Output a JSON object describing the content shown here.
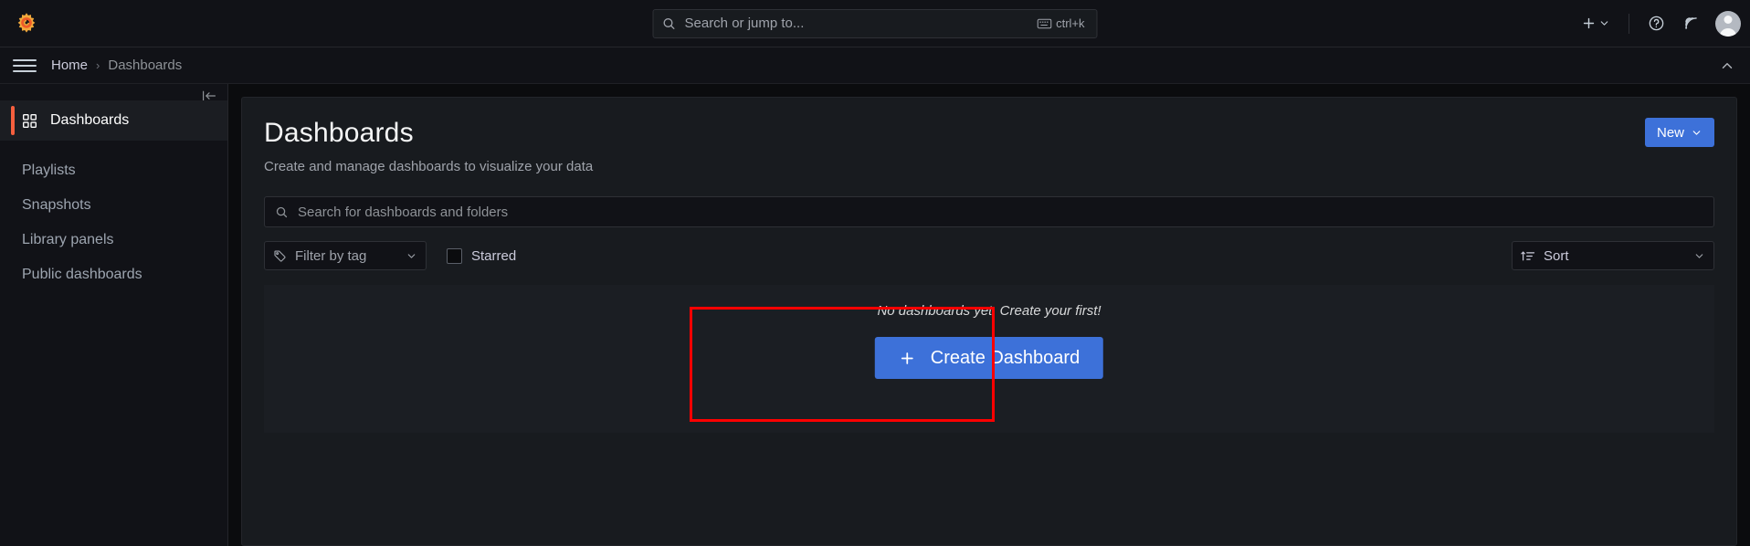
{
  "topnav": {
    "logo_icon": "grafana-logo-icon",
    "search": {
      "placeholder": "Search or jump to...",
      "icon": "search-icon",
      "shortcut": "ctrl+k",
      "shortcut_icon": "keyboard-icon"
    },
    "actions": {
      "plus_icon": "plus-icon",
      "plus_chevron_icon": "chevron-down-icon",
      "help_icon": "help-circle-icon",
      "news_icon": "rss-icon",
      "avatar_icon": "user-avatar-icon"
    }
  },
  "breadcrumb": {
    "menu_icon": "hamburger-menu-icon",
    "items": [
      {
        "label": "Home"
      },
      {
        "label": "Dashboards"
      }
    ],
    "separator": "›",
    "collapse_icon": "chevron-up-icon"
  },
  "sidebar": {
    "collapse_icon": "dock-left-icon",
    "items": [
      {
        "label": "Dashboards",
        "icon": "apps-grid-icon",
        "active": true
      },
      {
        "label": "Playlists",
        "icon": "",
        "active": false
      },
      {
        "label": "Snapshots",
        "icon": "",
        "active": false
      },
      {
        "label": "Library panels",
        "icon": "",
        "active": false
      },
      {
        "label": "Public dashboards",
        "icon": "",
        "active": false
      }
    ],
    "accent_color": "#f55f3e"
  },
  "main": {
    "title": "Dashboards",
    "subtitle": "Create and manage dashboards to visualize your data",
    "new_button": {
      "label": "New",
      "chevron_icon": "chevron-down-icon",
      "color": "#3d71d9"
    },
    "search": {
      "placeholder": "Search for dashboards and folders",
      "icon": "search-icon",
      "value": ""
    },
    "filters": {
      "tag_filter": {
        "label": "Filter by tag",
        "icon": "tag-icon",
        "chevron_icon": "chevron-down-icon"
      },
      "starred": {
        "label": "Starred",
        "checked": false
      },
      "sort": {
        "label": "Sort",
        "icon": "sort-amount-up-icon",
        "chevron_icon": "chevron-down-icon"
      }
    },
    "empty_state": {
      "message": "No dashboards yet. Create your first!",
      "button_label": "Create Dashboard",
      "button_icon": "plus-icon",
      "button_color": "#3d71d9"
    },
    "annotation": {
      "color": "#ff0000"
    }
  }
}
